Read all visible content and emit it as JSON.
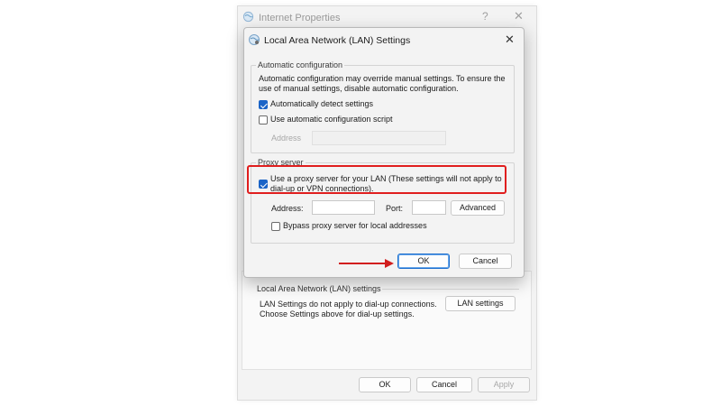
{
  "outer_window": {
    "title": "Internet Properties",
    "help_glyph": "?",
    "close_glyph": "✕",
    "lan_group_label": "Local Area Network (LAN) settings",
    "lan_description": "LAN Settings do not apply to dial-up connections. Choose Settings above for dial-up settings.",
    "lan_settings_button": "LAN settings",
    "ok_button": "OK",
    "cancel_button": "Cancel",
    "apply_button": "Apply"
  },
  "dialog": {
    "title": "Local Area Network (LAN) Settings",
    "close_glyph": "✕",
    "auto_config": {
      "label": "Automatic configuration",
      "description": "Automatic configuration may override manual settings.  To ensure the use of manual settings, disable automatic configuration.",
      "detect_label": "Automatically detect settings",
      "detect_checked": true,
      "script_label": "Use automatic configuration script",
      "script_checked": false,
      "address_label": "Address",
      "address_value": ""
    },
    "proxy": {
      "label": "Proxy server",
      "use_proxy_label": "Use a proxy server for your LAN (These settings will not apply to dial-up or VPN connections).",
      "use_proxy_checked": true,
      "address_label": "Address:",
      "address_value": "",
      "port_label": "Port:",
      "port_value": "",
      "advanced_button": "Advanced",
      "bypass_label": "Bypass proxy server for local addresses",
      "bypass_checked": false
    },
    "ok_button": "OK",
    "cancel_button": "Cancel"
  },
  "annotations": {
    "highlight_color": "#e01e1e",
    "arrow_color": "#d11e1e"
  },
  "colors": {
    "accent": "#1b64c7"
  }
}
